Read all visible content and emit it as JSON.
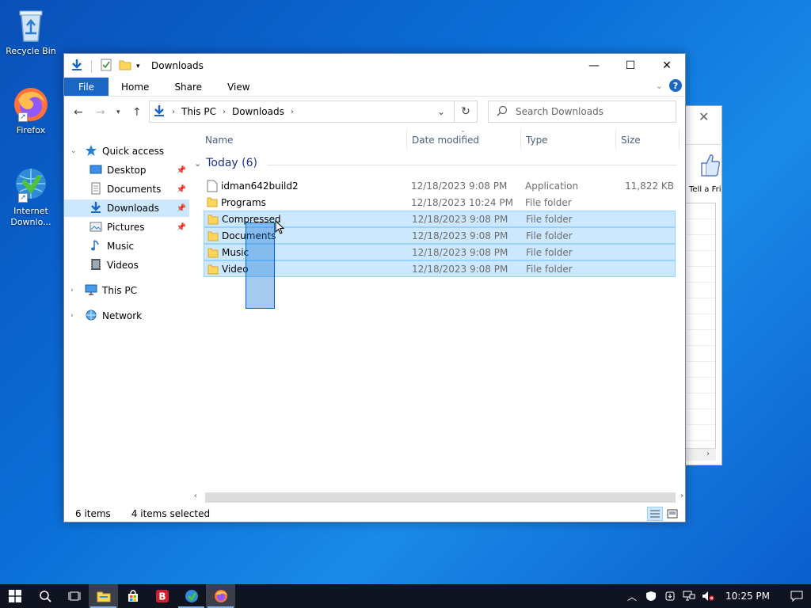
{
  "desktop": {
    "icons": [
      {
        "label": "Recycle Bin"
      },
      {
        "label": "Firefox"
      },
      {
        "label": "Internet Downlo..."
      }
    ]
  },
  "background_window": {
    "label": "Tell a Fri"
  },
  "explorer": {
    "title": "Downloads",
    "ribbon": {
      "file": "File",
      "tabs": [
        "Home",
        "Share",
        "View"
      ]
    },
    "address": {
      "crumbs": [
        "This PC",
        "Downloads"
      ]
    },
    "search": {
      "placeholder": "Search Downloads"
    },
    "sidebar": {
      "quick_access": "Quick access",
      "items": [
        "Desktop",
        "Documents",
        "Downloads",
        "Pictures",
        "Music",
        "Videos"
      ],
      "this_pc": "This PC",
      "network": "Network"
    },
    "columns": [
      "Name",
      "Date modified",
      "Type",
      "Size"
    ],
    "group": "Today (6)",
    "files": [
      {
        "name": "idman642build2",
        "date": "12/18/2023 9:08 PM",
        "type": "Application",
        "size": "11,822 KB"
      },
      {
        "name": "Programs",
        "date": "12/18/2023 10:24 PM",
        "type": "File folder",
        "size": ""
      },
      {
        "name": "Compressed",
        "date": "12/18/2023 9:08 PM",
        "type": "File folder",
        "size": ""
      },
      {
        "name": "Documents",
        "date": "12/18/2023 9:08 PM",
        "type": "File folder",
        "size": ""
      },
      {
        "name": "Music",
        "date": "12/18/2023 9:08 PM",
        "type": "File folder",
        "size": ""
      },
      {
        "name": "Video",
        "date": "12/18/2023 9:08 PM",
        "type": "File folder",
        "size": ""
      }
    ],
    "status": {
      "items": "6 items",
      "selected": "4 items selected"
    }
  },
  "taskbar": {
    "clock": "10:25 PM"
  },
  "colors": {
    "accent": "#1a66c4",
    "selection": "#cce8ff",
    "selection_border": "#99d1ff"
  }
}
